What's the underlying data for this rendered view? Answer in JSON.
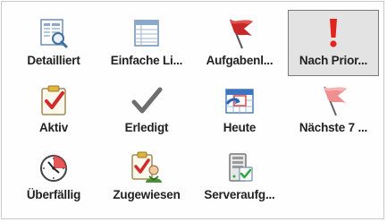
{
  "gallery": {
    "items": [
      {
        "label": "Detailliert",
        "icon": "detailed-list-icon"
      },
      {
        "label": "Einfache Li...",
        "icon": "simple-list-icon"
      },
      {
        "label": "Aufgabenl...",
        "icon": "red-flag-icon"
      },
      {
        "label": "Nach Prior...",
        "icon": "exclamation-icon",
        "selected": true
      },
      {
        "label": "Aktiv",
        "icon": "clipboard-check-icon"
      },
      {
        "label": "Erledigt",
        "icon": "checkmark-icon"
      },
      {
        "label": "Heute",
        "icon": "calendar-today-icon"
      },
      {
        "label": "Nächste 7 ...",
        "icon": "pink-flag-icon"
      },
      {
        "label": "Überfällig",
        "icon": "clock-icon"
      },
      {
        "label": "Zugewiesen",
        "icon": "assigned-user-icon"
      },
      {
        "label": "Serveraufg...",
        "icon": "server-task-icon"
      }
    ]
  },
  "colors": {
    "selected_bg": "#e3e3e3",
    "selected_border": "#7a7a7a",
    "flag_red": "#c8282a",
    "flag_pink": "#f08f8f",
    "check_red": "#d32a2a"
  }
}
